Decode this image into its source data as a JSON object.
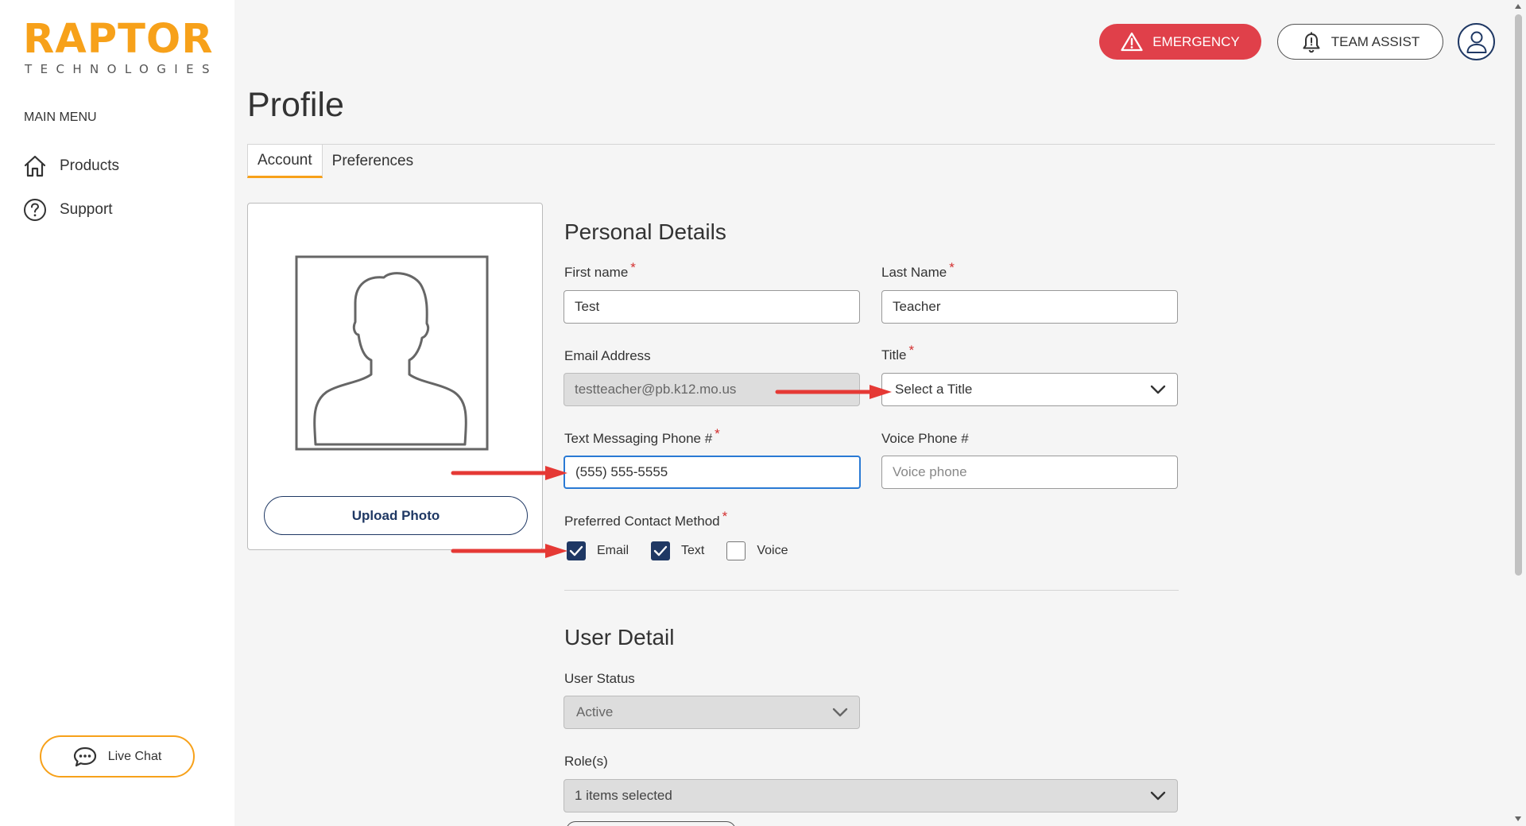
{
  "logo": {
    "name": "RAPTOR",
    "tagline": "TECHNOLOGIES"
  },
  "sidebar": {
    "heading": "MAIN MENU",
    "items": [
      {
        "label": "Products",
        "icon": "home-icon"
      },
      {
        "label": "Support",
        "icon": "question-circle-icon"
      }
    ],
    "live_chat": "Live Chat"
  },
  "header": {
    "emergency": "EMERGENCY",
    "team_assist": "TEAM ASSIST"
  },
  "page": {
    "title": "Profile",
    "tabs": [
      {
        "label": "Account",
        "active": true
      },
      {
        "label": "Preferences",
        "active": false
      }
    ]
  },
  "photo": {
    "upload_label": "Upload Photo"
  },
  "personal": {
    "heading": "Personal Details",
    "first_name": {
      "label": "First name",
      "value": "Test"
    },
    "last_name": {
      "label": "Last Name",
      "value": "Teacher"
    },
    "email": {
      "label": "Email Address",
      "value": "testteacher@pb.k12.mo.us"
    },
    "title": {
      "label": "Title",
      "value": "Select a Title"
    },
    "text_phone": {
      "label": "Text Messaging Phone #",
      "value": "(555) 555-5555"
    },
    "voice_phone": {
      "label": "Voice Phone #",
      "placeholder": "Voice phone"
    },
    "contact": {
      "label": "Preferred Contact Method",
      "options": [
        {
          "label": "Email",
          "checked": true
        },
        {
          "label": "Text",
          "checked": true
        },
        {
          "label": "Voice",
          "checked": false
        }
      ]
    }
  },
  "user_detail": {
    "heading": "User Detail",
    "status": {
      "label": "User Status",
      "value": "Active"
    },
    "roles": {
      "label": "Role(s)",
      "value": "1 items selected"
    }
  },
  "colors": {
    "brand": "#f7a11a",
    "emergency": "#e0404a",
    "navy": "#1f3864",
    "required": "#d32f2f",
    "annotation_arrow": "#e53935"
  }
}
